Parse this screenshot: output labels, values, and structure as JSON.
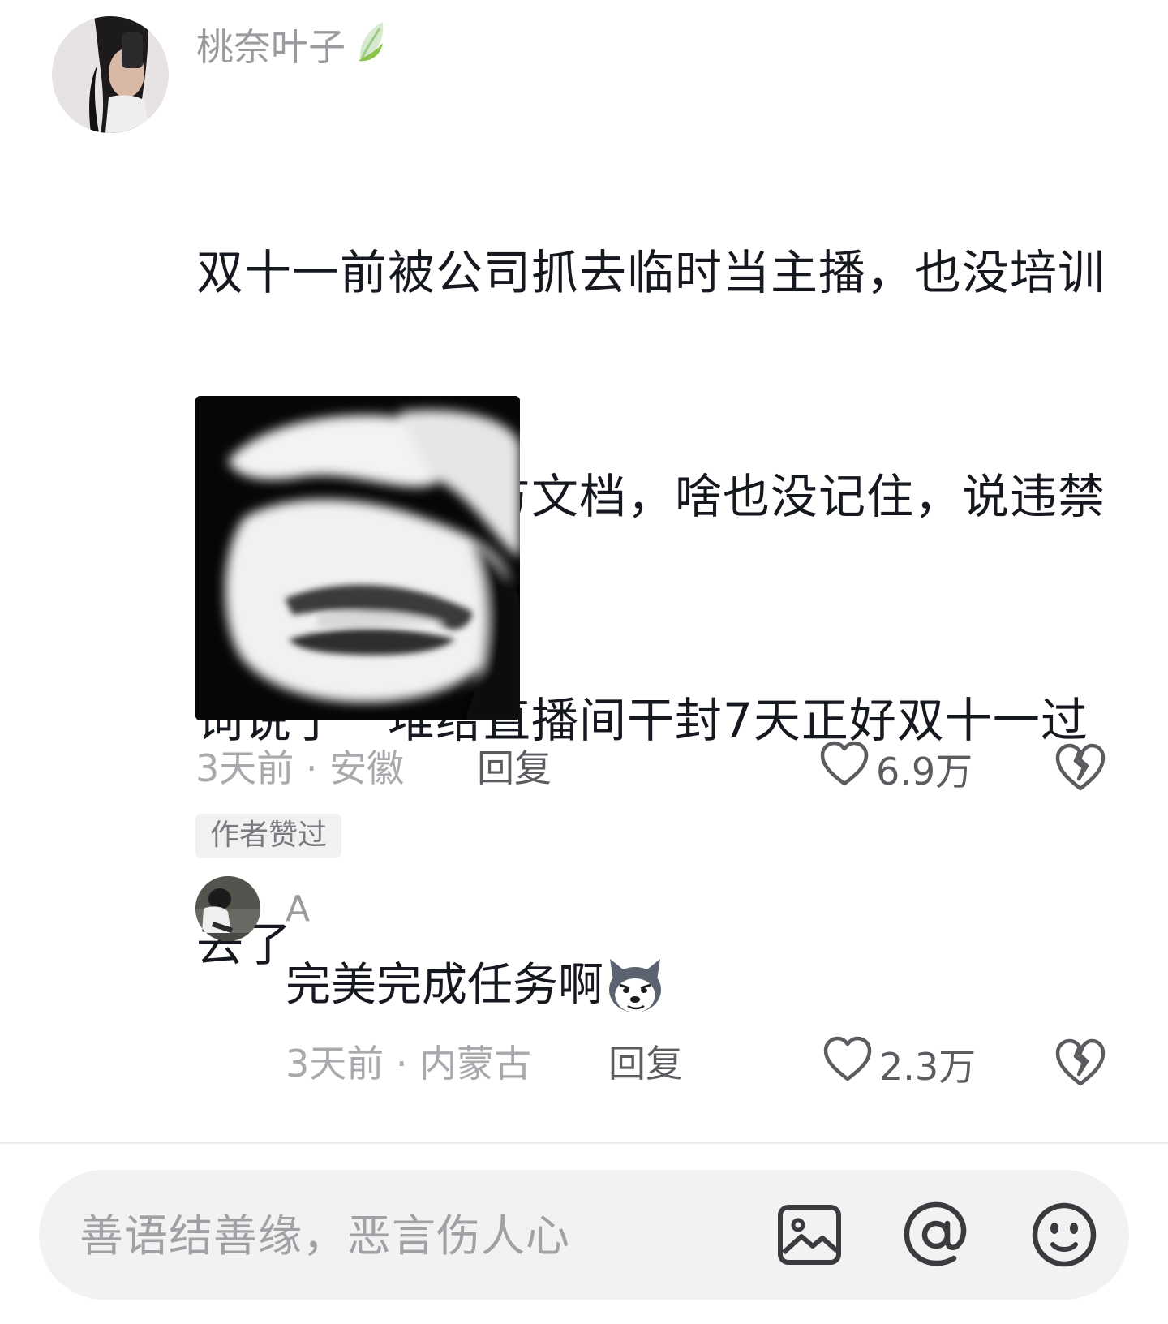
{
  "main_comment": {
    "username": "桃奈叶子",
    "badge_icon": "leaf-icon",
    "text_lines": [
      "双十一前被公司抓去临时当主播，也没培训",
      "自己看了看官方文档，啥也没记住，说违禁",
      "词说了一堆给直播间干封7天正好双十一过",
      "去了"
    ],
    "time_location": "3天前 · 安徽",
    "reply_label": "回复",
    "like_count": "6.9万",
    "author_liked_label": "作者赞过"
  },
  "reply_comment": {
    "username": "A",
    "text": "完美完成任务啊",
    "emoji_icon": "husky-dog-emoji",
    "time_location": "3天前 · 内蒙古",
    "reply_label": "回复",
    "like_count": "2.3万"
  },
  "input_bar": {
    "placeholder": "善语结善缘，恶言伤人心",
    "icons": [
      "image-icon",
      "at-icon",
      "emoji-icon"
    ]
  },
  "colors": {
    "text_primary": "#16181f",
    "text_secondary": "#9b9b9f",
    "action_text": "#5b5b60",
    "input_background": "#f2f2f3",
    "badge_background": "#f1f1f2",
    "leaf_green": "#8bc34a"
  }
}
